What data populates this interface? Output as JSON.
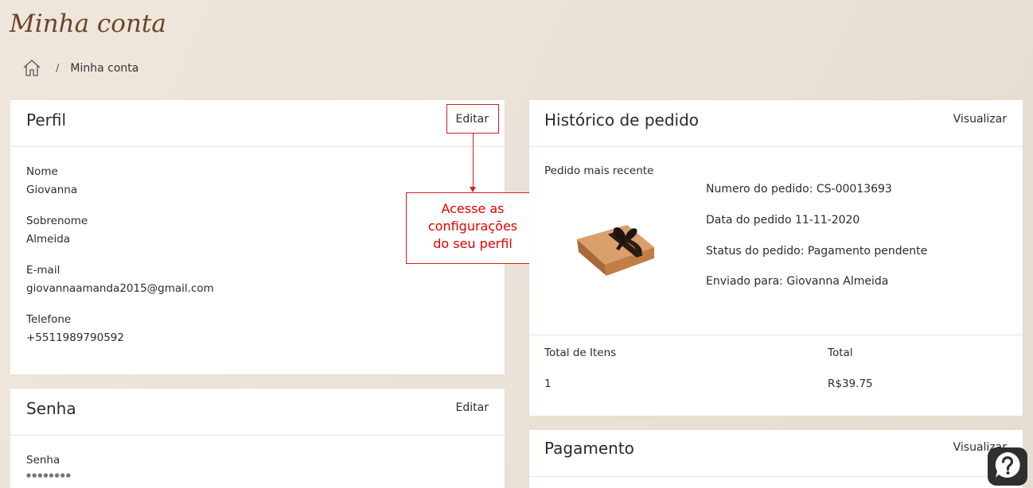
{
  "page": {
    "title": "Minha conta"
  },
  "breadcrumb": {
    "separator": "/",
    "current": "Minha conta"
  },
  "profile": {
    "title": "Perfil",
    "edit_label": "Editar",
    "fields": [
      {
        "label": "Nome",
        "value": "Giovanna"
      },
      {
        "label": "Sobrenome",
        "value": "Almeida"
      },
      {
        "label": "E-mail",
        "value": "giovannaamanda2015@gmail.com"
      },
      {
        "label": "Telefone",
        "value": "+5511989790592"
      }
    ]
  },
  "callout": {
    "line1": "Acesse as",
    "line2": "configurações",
    "line3": "do seu perfil"
  },
  "password": {
    "title": "Senha",
    "edit_label": "Editar",
    "label": "Senha",
    "value": "●●●●●●●●"
  },
  "orders": {
    "title": "Histórico de pedido",
    "view_label": "Visualizar",
    "recent_label": "Pedido mais recente",
    "order_number": "Numero do pedido: CS-00013693",
    "order_date": "Data do pedido 11-11-2020",
    "order_status": "Status do pedido: Pagamento pendente",
    "shipped_to": "Enviado para: Giovanna Almeida",
    "total_items_label": "Total de Itens",
    "total_label": "Total",
    "total_items_value": "1",
    "total_value": "R$39.75"
  },
  "payment": {
    "title": "Pagamento",
    "view_label": "Visualizar"
  },
  "icons": {
    "home": "home-icon",
    "help": "help-icon",
    "product": "chocolate-box-image"
  },
  "colors": {
    "accent_red": "#d42020",
    "title_brown": "#6b4426",
    "help_bg": "#2f2f2f"
  }
}
